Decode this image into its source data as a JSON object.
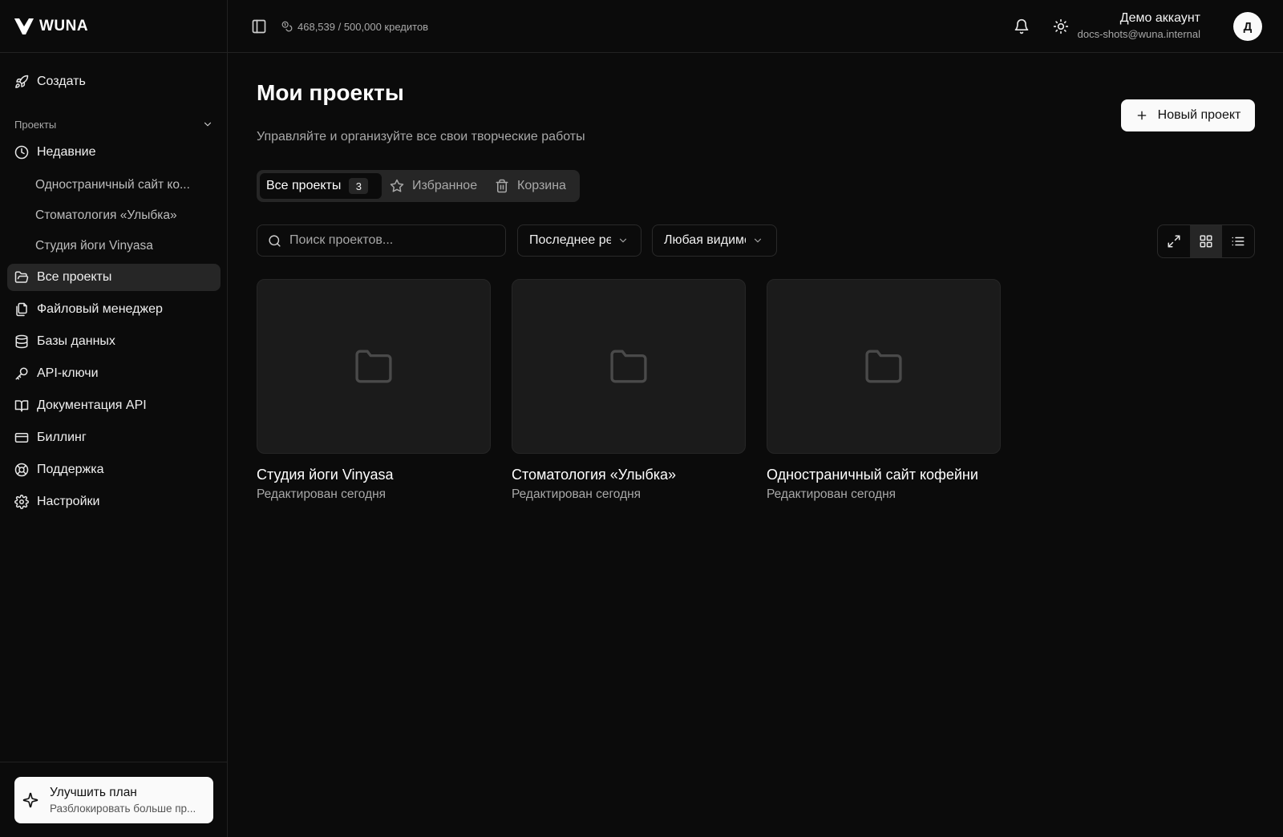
{
  "app": {
    "name": "WUNA"
  },
  "sidebar": {
    "create_label": "Создать",
    "section_label": "Проекты",
    "recent_label": "Недавние",
    "recent_items": [
      "Одностраничный сайт ко...",
      "Стоматология «Улыбка»",
      "Студия йоги Vinyasa"
    ],
    "items": [
      {
        "label": "Все проекты",
        "icon": "folder-open-icon",
        "active": true
      },
      {
        "label": "Файловый менеджер",
        "icon": "files-icon"
      },
      {
        "label": "Базы данных",
        "icon": "database-icon"
      },
      {
        "label": "API-ключи",
        "icon": "key-icon"
      },
      {
        "label": "Документация API",
        "icon": "book-icon"
      },
      {
        "label": "Биллинг",
        "icon": "credit-card-icon"
      },
      {
        "label": "Поддержка",
        "icon": "life-buoy-icon"
      },
      {
        "label": "Настройки",
        "icon": "gear-icon"
      }
    ],
    "upgrade": {
      "title": "Улучшить план",
      "subtitle": "Разблокировать больше пр..."
    }
  },
  "topbar": {
    "credits": "468,539 / 500,000 кредитов",
    "account_name": "Демо аккаунт",
    "account_email": "docs-shots@wuna.internal",
    "avatar_letter": "Д"
  },
  "main": {
    "title": "Мои проекты",
    "subtitle": "Управляйте и организуйте все свои творческие работы",
    "new_project_label": "Новый проект",
    "tabs": [
      {
        "label": "Все проекты",
        "count": "3",
        "active": true
      },
      {
        "label": "Избранное",
        "icon": "star-icon"
      },
      {
        "label": "Корзина",
        "icon": "trash-icon"
      }
    ],
    "search_placeholder": "Поиск проектов...",
    "sort_value": "Последнее редактирование",
    "visibility_value": "Любая видимость",
    "view_mode": "grid",
    "projects": [
      {
        "title": "Студия йоги Vinyasa",
        "subtitle": "Редактирован сегодня"
      },
      {
        "title": "Стоматология «Улыбка»",
        "subtitle": "Редактирован сегодня"
      },
      {
        "title": "Одностраничный сайт кофейни",
        "subtitle": "Редактирован сегодня"
      }
    ]
  },
  "colors": {
    "background": "#0b0b0b",
    "surface": "#262626",
    "card": "#1b1b1b",
    "accent_button": "#fafafa",
    "muted_text": "#a8a8a8"
  }
}
